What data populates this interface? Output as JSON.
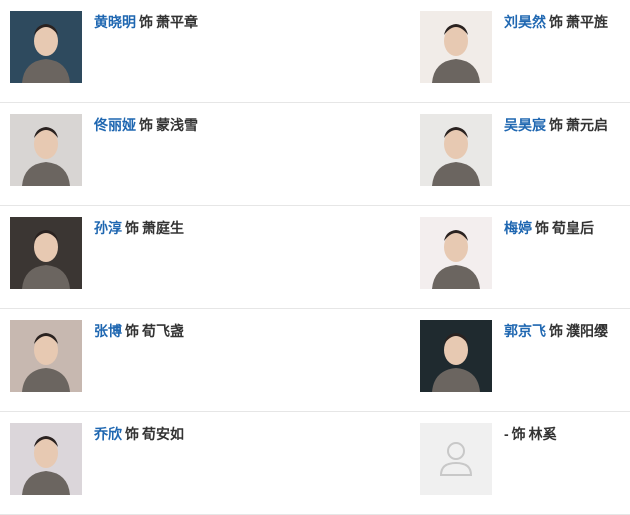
{
  "as_word": "饰",
  "rows": [
    {
      "left": {
        "actor": "黄晓明",
        "role": "萧平章",
        "photo": "actor-photo",
        "tone": "#2e4a5e"
      },
      "right": {
        "actor": "刘昊然",
        "role": "萧平旌",
        "photo": "actor-photo",
        "tone": "#f1ece8"
      }
    },
    {
      "left": {
        "actor": "佟丽娅",
        "role": "蒙浅雪",
        "photo": "actor-photo",
        "tone": "#d8d5d3"
      },
      "right": {
        "actor": "吴昊宸",
        "role": "萧元启",
        "photo": "actor-photo",
        "tone": "#e9e8e6"
      }
    },
    {
      "left": {
        "actor": "孙淳",
        "role": "萧庭生",
        "photo": "actor-photo",
        "tone": "#3b3633"
      },
      "right": {
        "actor": "梅婷",
        "role": "荀皇后",
        "photo": "actor-photo",
        "tone": "#f3eeee"
      }
    },
    {
      "left": {
        "actor": "张博",
        "role": "荀飞盏",
        "photo": "actor-photo",
        "tone": "#c7b8b0"
      },
      "right": {
        "actor": "郭京飞",
        "role": "濮阳缨",
        "photo": "actor-photo",
        "tone": "#1f2a2f"
      }
    },
    {
      "left": {
        "actor": "乔欣",
        "role": "荀安如",
        "photo": "actor-photo",
        "tone": "#dbd6da"
      },
      "right": {
        "actor": "-",
        "role": "林奚",
        "photo": "placeholder-avatar",
        "tone": "#f0f0f0"
      }
    }
  ]
}
